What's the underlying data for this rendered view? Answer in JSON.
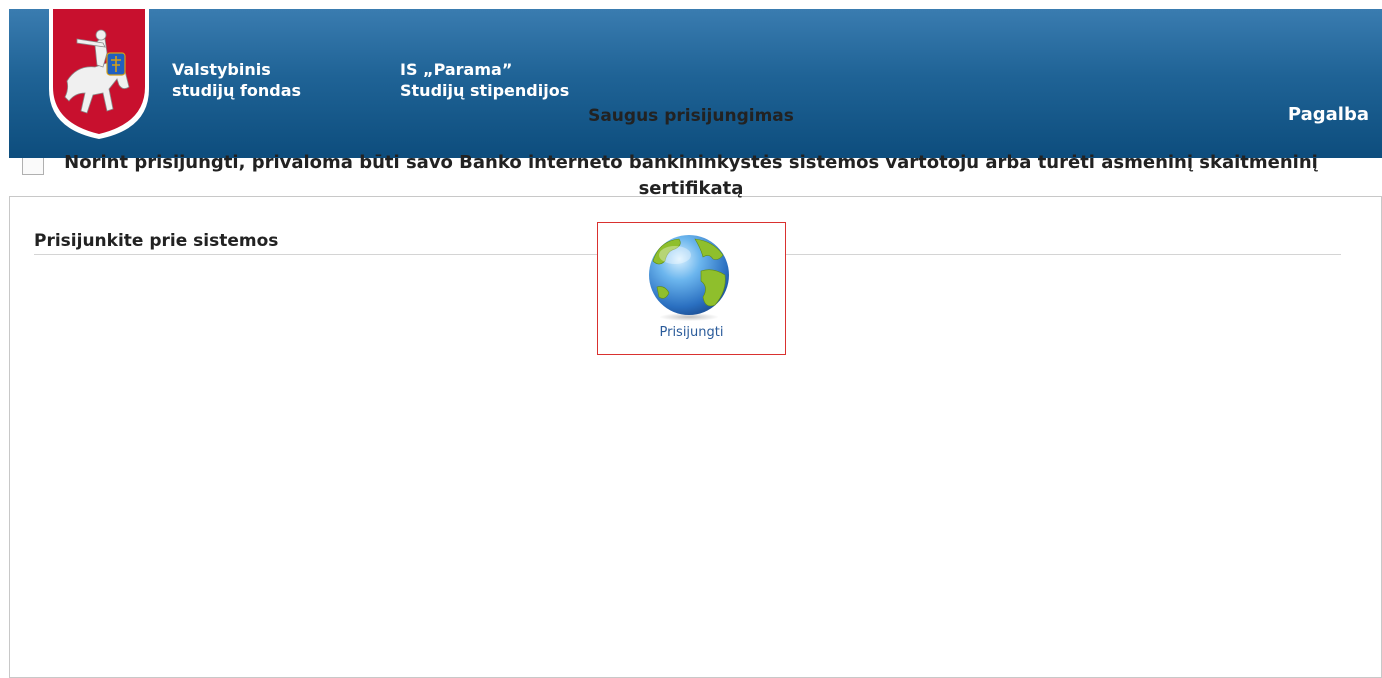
{
  "header": {
    "org_line1": "Valstybinis",
    "org_line2": "studijų fondas",
    "system_line1": "IS „Parama”",
    "system_line2": "Studijų stipendijos",
    "help_link": "Pagalba",
    "background_color": "#1f6396"
  },
  "panel": {
    "title": "Prisijunkite prie sistemos",
    "secure_heading": "Saugus prisijungimas",
    "note": "Norint prisijungti, privaloma būti savo Banko interneto bankininkystės sistemos vartotoju arba turėti asmeninį skaitmeninį sertifikatą"
  },
  "login": {
    "label": "Prisijungti",
    "icon": "globe-icon",
    "border_color": "#d9312f"
  }
}
